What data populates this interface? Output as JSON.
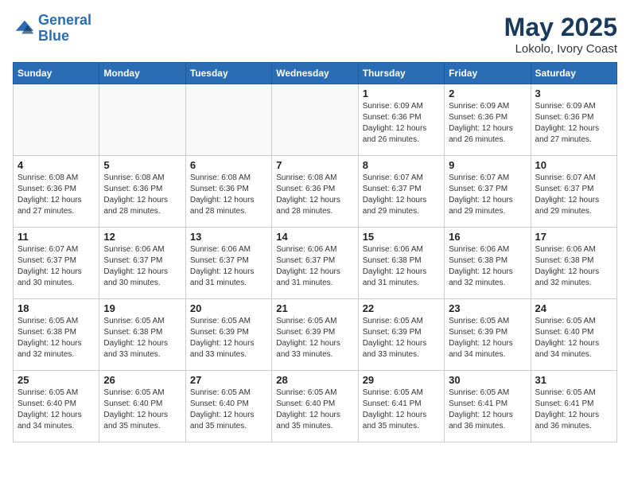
{
  "header": {
    "logo_line1": "General",
    "logo_line2": "Blue",
    "month_year": "May 2025",
    "location": "Lokolo, Ivory Coast"
  },
  "weekdays": [
    "Sunday",
    "Monday",
    "Tuesday",
    "Wednesday",
    "Thursday",
    "Friday",
    "Saturday"
  ],
  "weeks": [
    [
      {
        "day": "",
        "info": ""
      },
      {
        "day": "",
        "info": ""
      },
      {
        "day": "",
        "info": ""
      },
      {
        "day": "",
        "info": ""
      },
      {
        "day": "1",
        "info": "Sunrise: 6:09 AM\nSunset: 6:36 PM\nDaylight: 12 hours\nand 26 minutes."
      },
      {
        "day": "2",
        "info": "Sunrise: 6:09 AM\nSunset: 6:36 PM\nDaylight: 12 hours\nand 26 minutes."
      },
      {
        "day": "3",
        "info": "Sunrise: 6:09 AM\nSunset: 6:36 PM\nDaylight: 12 hours\nand 27 minutes."
      }
    ],
    [
      {
        "day": "4",
        "info": "Sunrise: 6:08 AM\nSunset: 6:36 PM\nDaylight: 12 hours\nand 27 minutes."
      },
      {
        "day": "5",
        "info": "Sunrise: 6:08 AM\nSunset: 6:36 PM\nDaylight: 12 hours\nand 28 minutes."
      },
      {
        "day": "6",
        "info": "Sunrise: 6:08 AM\nSunset: 6:36 PM\nDaylight: 12 hours\nand 28 minutes."
      },
      {
        "day": "7",
        "info": "Sunrise: 6:08 AM\nSunset: 6:36 PM\nDaylight: 12 hours\nand 28 minutes."
      },
      {
        "day": "8",
        "info": "Sunrise: 6:07 AM\nSunset: 6:37 PM\nDaylight: 12 hours\nand 29 minutes."
      },
      {
        "day": "9",
        "info": "Sunrise: 6:07 AM\nSunset: 6:37 PM\nDaylight: 12 hours\nand 29 minutes."
      },
      {
        "day": "10",
        "info": "Sunrise: 6:07 AM\nSunset: 6:37 PM\nDaylight: 12 hours\nand 29 minutes."
      }
    ],
    [
      {
        "day": "11",
        "info": "Sunrise: 6:07 AM\nSunset: 6:37 PM\nDaylight: 12 hours\nand 30 minutes."
      },
      {
        "day": "12",
        "info": "Sunrise: 6:06 AM\nSunset: 6:37 PM\nDaylight: 12 hours\nand 30 minutes."
      },
      {
        "day": "13",
        "info": "Sunrise: 6:06 AM\nSunset: 6:37 PM\nDaylight: 12 hours\nand 31 minutes."
      },
      {
        "day": "14",
        "info": "Sunrise: 6:06 AM\nSunset: 6:37 PM\nDaylight: 12 hours\nand 31 minutes."
      },
      {
        "day": "15",
        "info": "Sunrise: 6:06 AM\nSunset: 6:38 PM\nDaylight: 12 hours\nand 31 minutes."
      },
      {
        "day": "16",
        "info": "Sunrise: 6:06 AM\nSunset: 6:38 PM\nDaylight: 12 hours\nand 32 minutes."
      },
      {
        "day": "17",
        "info": "Sunrise: 6:06 AM\nSunset: 6:38 PM\nDaylight: 12 hours\nand 32 minutes."
      }
    ],
    [
      {
        "day": "18",
        "info": "Sunrise: 6:05 AM\nSunset: 6:38 PM\nDaylight: 12 hours\nand 32 minutes."
      },
      {
        "day": "19",
        "info": "Sunrise: 6:05 AM\nSunset: 6:38 PM\nDaylight: 12 hours\nand 33 minutes."
      },
      {
        "day": "20",
        "info": "Sunrise: 6:05 AM\nSunset: 6:39 PM\nDaylight: 12 hours\nand 33 minutes."
      },
      {
        "day": "21",
        "info": "Sunrise: 6:05 AM\nSunset: 6:39 PM\nDaylight: 12 hours\nand 33 minutes."
      },
      {
        "day": "22",
        "info": "Sunrise: 6:05 AM\nSunset: 6:39 PM\nDaylight: 12 hours\nand 33 minutes."
      },
      {
        "day": "23",
        "info": "Sunrise: 6:05 AM\nSunset: 6:39 PM\nDaylight: 12 hours\nand 34 minutes."
      },
      {
        "day": "24",
        "info": "Sunrise: 6:05 AM\nSunset: 6:40 PM\nDaylight: 12 hours\nand 34 minutes."
      }
    ],
    [
      {
        "day": "25",
        "info": "Sunrise: 6:05 AM\nSunset: 6:40 PM\nDaylight: 12 hours\nand 34 minutes."
      },
      {
        "day": "26",
        "info": "Sunrise: 6:05 AM\nSunset: 6:40 PM\nDaylight: 12 hours\nand 35 minutes."
      },
      {
        "day": "27",
        "info": "Sunrise: 6:05 AM\nSunset: 6:40 PM\nDaylight: 12 hours\nand 35 minutes."
      },
      {
        "day": "28",
        "info": "Sunrise: 6:05 AM\nSunset: 6:40 PM\nDaylight: 12 hours\nand 35 minutes."
      },
      {
        "day": "29",
        "info": "Sunrise: 6:05 AM\nSunset: 6:41 PM\nDaylight: 12 hours\nand 35 minutes."
      },
      {
        "day": "30",
        "info": "Sunrise: 6:05 AM\nSunset: 6:41 PM\nDaylight: 12 hours\nand 36 minutes."
      },
      {
        "day": "31",
        "info": "Sunrise: 6:05 AM\nSunset: 6:41 PM\nDaylight: 12 hours\nand 36 minutes."
      }
    ]
  ]
}
